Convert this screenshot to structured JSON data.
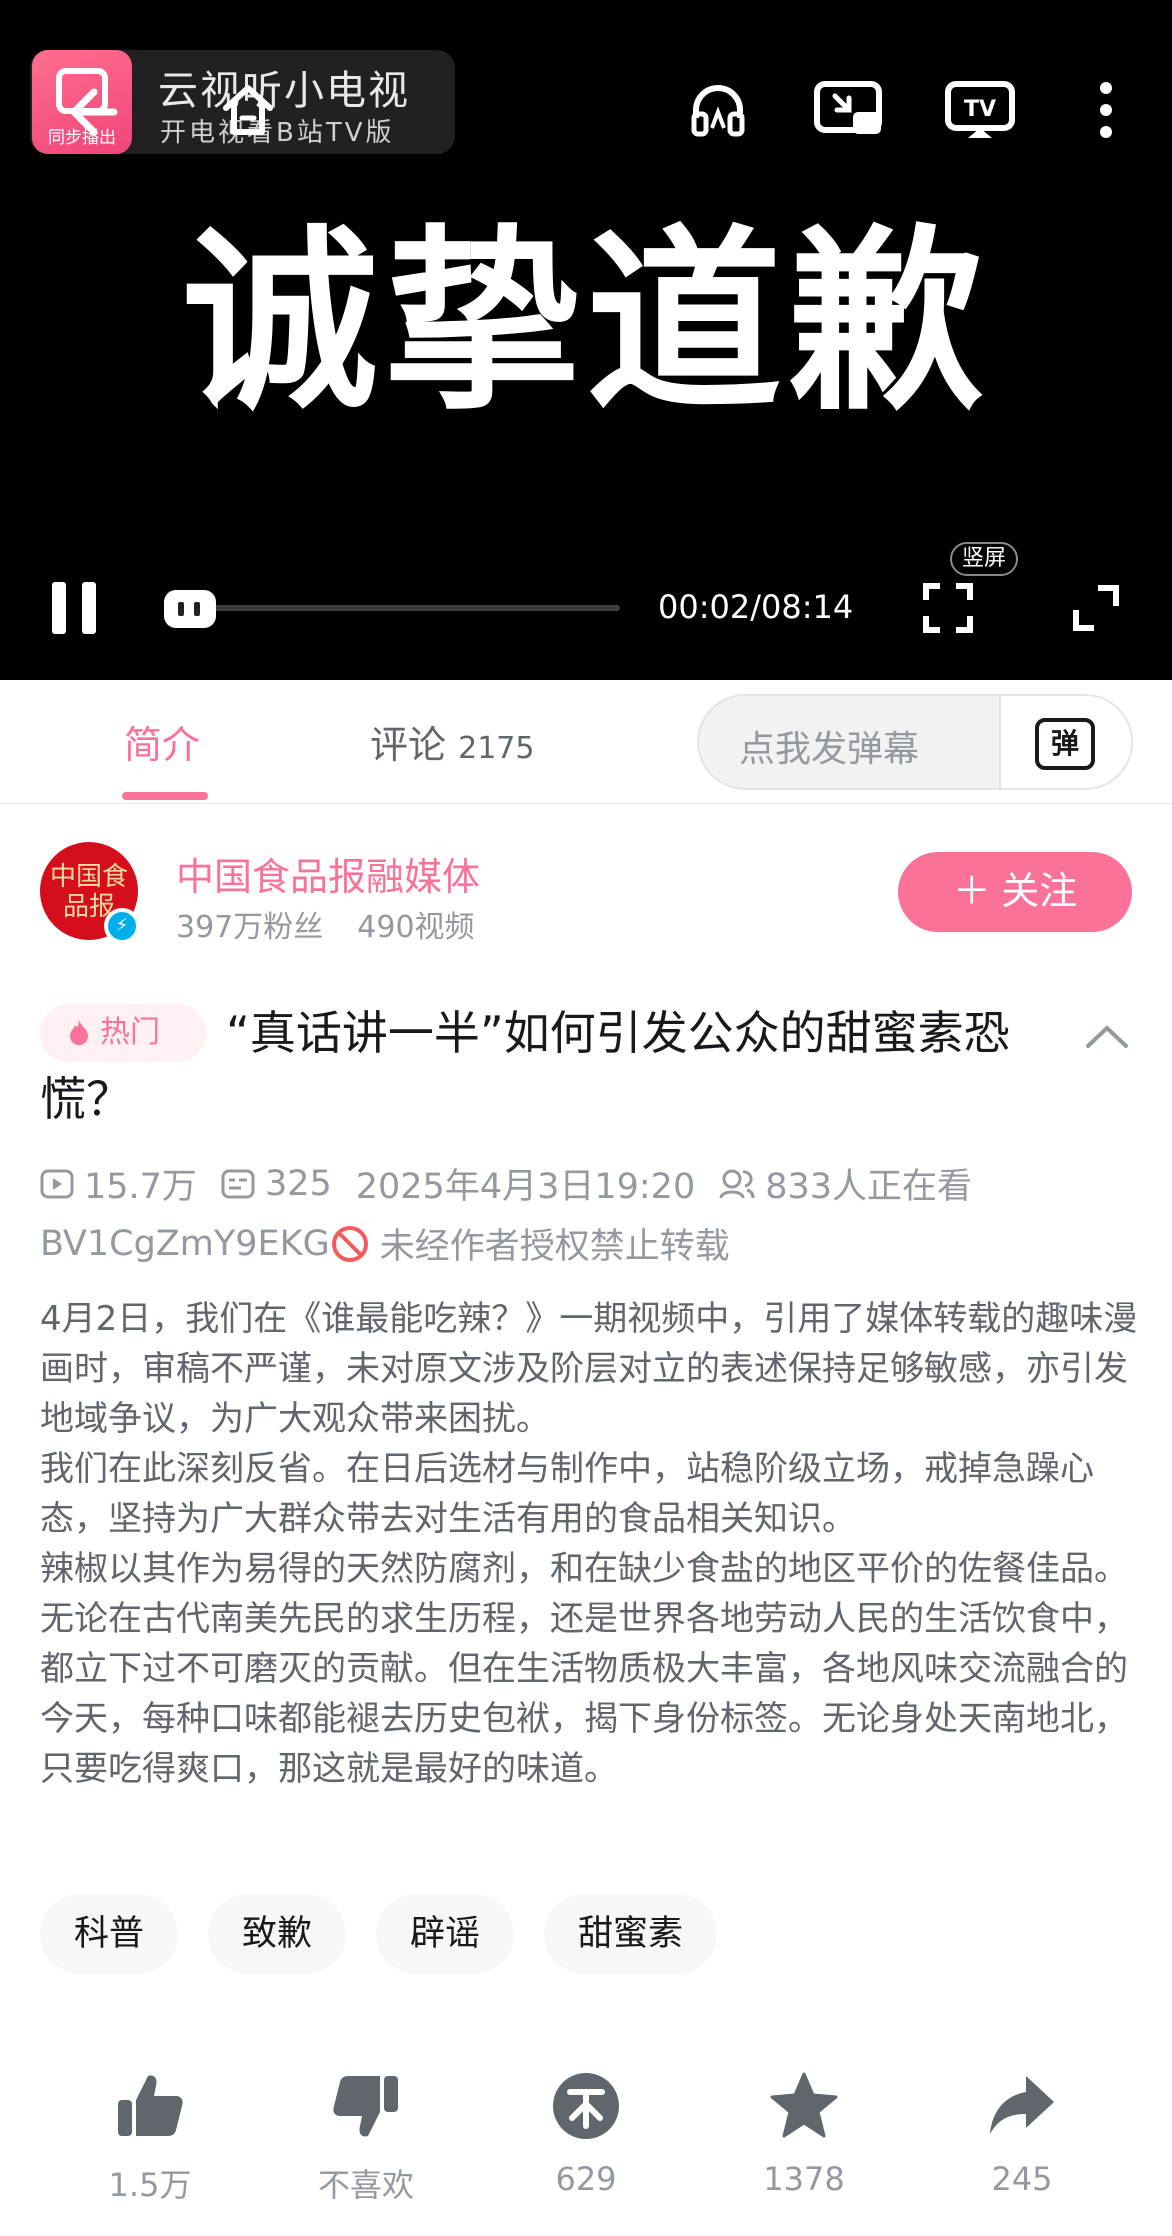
{
  "player": {
    "promo_badge": "同步播出",
    "promo_title": "云视听小电视",
    "promo_subtitle": "开电视看B站TV版",
    "faint_watermark": "中国食品报融媒体",
    "headline": "诚挚道歉",
    "time": "00:02/08:14",
    "progress_fraction": 0.004,
    "portrait_label": "竖屏",
    "icons": [
      "back-arrow-icon",
      "home-icon",
      "headphones-icon",
      "cast-screen-icon",
      "tv-icon",
      "more-icon",
      "pause-icon",
      "fullscreen-icon",
      "expand-icon"
    ]
  },
  "tabs": {
    "intro": "简介",
    "comments": "评论",
    "comments_count": "2175",
    "danmaku_placeholder": "点我发弹幕",
    "danmaku_button": "弹"
  },
  "uploader": {
    "avatar_text": "中国食品报",
    "name": "中国食品报融媒体",
    "fans": "397万粉丝",
    "videos": "490视频",
    "follow": "＋ 关注"
  },
  "video": {
    "hot_badge": "热门",
    "title": "“真话讲一半”如何引发公众的甜蜜素恐慌？",
    "views": "15.7万",
    "danmaku_count": "325",
    "date": "2025年4月3日19:20",
    "watching": "833人正在看",
    "bvid": "BV1CgZmY9EKG",
    "copyright": "未经作者授权禁止转载",
    "description": [
      "4月2日，我们在《谁最能吃辣？》一期视频中，引用了媒体转载的趣味漫画时，审稿不严谨，未对原文涉及阶层对立的表述保持足够敏感，亦引发地域争议，为广大观众带来困扰。",
      "我们在此深刻反省。在日后选材与制作中，站稳阶级立场，戒掉急躁心态，坚持为广大群众带去对生活有用的食品相关知识。",
      "辣椒以其作为易得的天然防腐剂，和在缺少食盐的地区平价的佐餐佳品。无论在古代南美先民的求生历程，还是世界各地劳动人民的生活饮食中，都立下过不可磨灭的贡献。但在生活物质极大丰富，各地风味交流融合的今天，每种口味都能褪去历史包袱，揭下身份标签。无论身处天南地北，只要吃得爽口，那这就是最好的味道。"
    ],
    "tags": [
      "科普",
      "致歉",
      "辟谣",
      "甜蜜素"
    ]
  },
  "actions": {
    "like": "1.5万",
    "dislike": "不喜欢",
    "coin": "629",
    "favorite": "1378",
    "share": "245"
  },
  "colors": {
    "brand_pink": "#fb7299",
    "player_bg": "#000000",
    "muted_text": "#9499a0",
    "body_text": "#61666d",
    "icon_gray": "#61666d"
  }
}
